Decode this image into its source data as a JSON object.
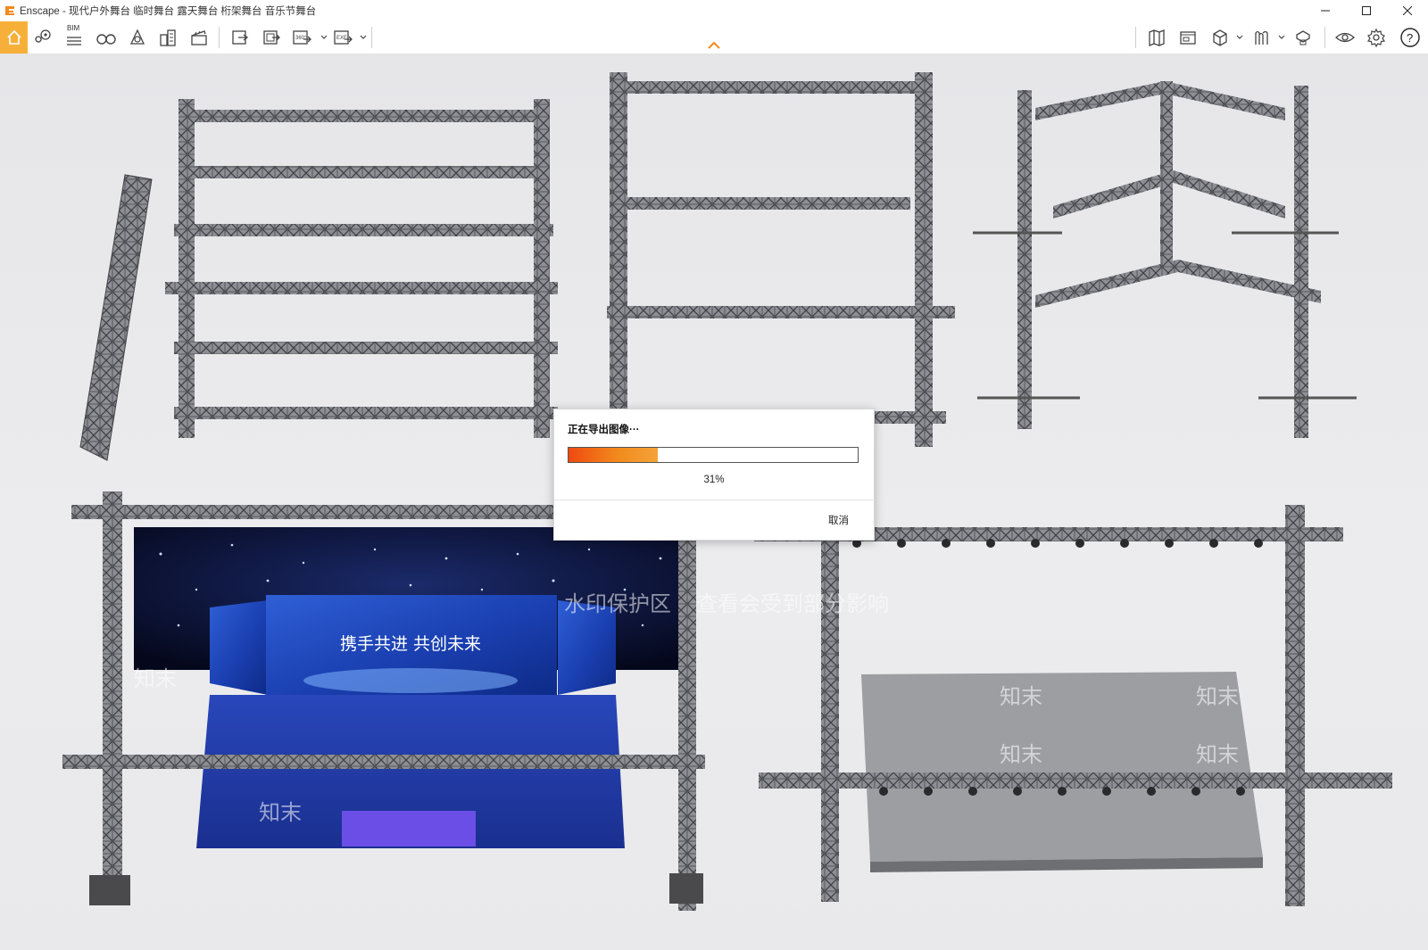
{
  "window": {
    "app_name": "Enscape",
    "title": "Enscape - 现代户外舞台 临时舞台 露天舞台 桁架舞台 音乐节舞台"
  },
  "toolbar": {
    "bim_label": "BIM",
    "left_icons": [
      "home-icon",
      "location-pin-icon",
      "bim-list-icon",
      "binoculars-icon",
      "bell-icon",
      "buildings-icon",
      "clapperboard-icon",
      "screenshot-icon",
      "batch-render-icon",
      "panorama-360-icon",
      "export-exe-icon"
    ],
    "right_icons": [
      "map-icon",
      "sticker-icon",
      "cube-icon",
      "asset-library-icon",
      "materials-icon",
      "visual-settings-eye-icon",
      "settings-gear-icon",
      "help-icon"
    ],
    "accent_color": "#f6b03a"
  },
  "dialog": {
    "title": "正在导出图像···",
    "progress_fraction": 0.31,
    "progress_label": "31%",
    "cancel_label": "取消"
  },
  "watermark": {
    "text_main": "水印保护区",
    "text_note": "查看会受到部分影响",
    "text_brand": "知末"
  },
  "stage_screen": {
    "slogan": "携手共进 共创未来"
  }
}
